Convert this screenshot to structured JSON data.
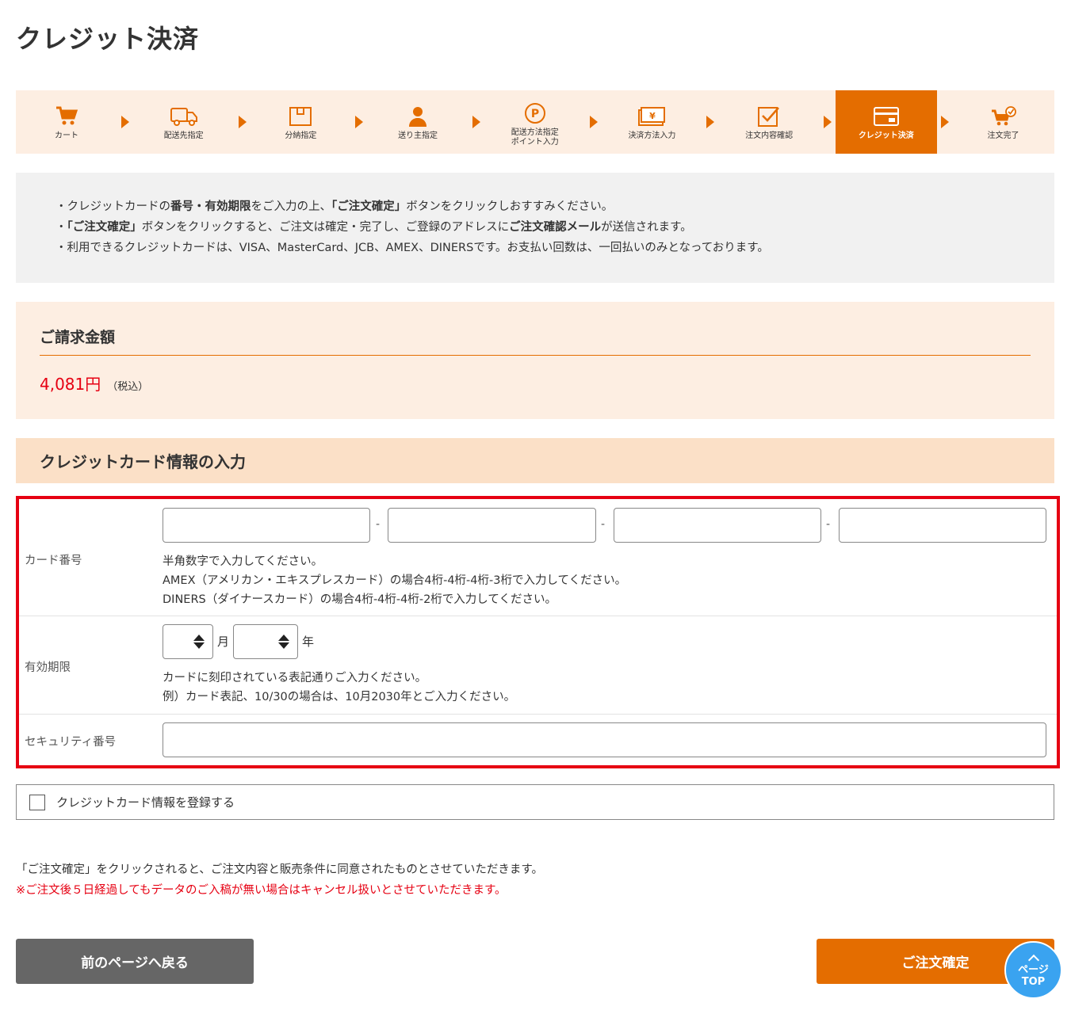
{
  "page": {
    "title": "クレジット決済"
  },
  "stepper": {
    "steps": [
      {
        "label": "カート",
        "icon": "cart-icon"
      },
      {
        "label": "配送先指定",
        "icon": "truck-icon"
      },
      {
        "label": "分納指定",
        "icon": "box-icon"
      },
      {
        "label": "送り主指定",
        "icon": "person-icon"
      },
      {
        "label": "配送方法指定\nポイント入力",
        "icon": "point-icon"
      },
      {
        "label": "決済方法入力",
        "icon": "yen-bill-icon"
      },
      {
        "label": "注文内容確認",
        "icon": "check-document-icon"
      },
      {
        "label": "クレジット決済",
        "icon": "credit-card-icon",
        "active": true
      },
      {
        "label": "注文完了",
        "icon": "cart-check-icon"
      }
    ],
    "accent": "#e46d00"
  },
  "notice": {
    "line1": {
      "a": "・クレジットカードの",
      "b": "番号・有効期限",
      "c": "をご入力の上、",
      "d": "「ご注文確定」",
      "e": "ボタンをクリックしおすすみください。"
    },
    "line2": {
      "a": "・",
      "b": "「ご注文確定」",
      "c": "ボタンをクリックすると、ご注文は確定・完了し、ご登録のアドレスに",
      "d": "ご注文確認メール",
      "e": "が送信されます。"
    },
    "line3": "・利用できるクレジットカードは、VISA、MasterCard、JCB、AMEX、DINERSです。お支払い回数は、一回払いのみとなっております。"
  },
  "billing": {
    "heading": "ご請求金額",
    "amount": "4,081円",
    "tax_note": "（税込）"
  },
  "card_section": {
    "heading": "クレジットカード情報の入力",
    "card_number": {
      "label": "カード番号",
      "separator": "-",
      "help1": "半角数字で入力してください。",
      "help2": "AMEX（アメリカン・エキスプレスカード）の場合4桁-4桁-4桁-3桁で入力してください。",
      "help3": "DINERS（ダイナースカード）の場合4桁-4桁-4桁-2桁で入力してください。"
    },
    "expiry": {
      "label": "有効期限",
      "month_unit": "月",
      "year_unit": "年",
      "help1": "カードに刻印されている表記通りご入力ください。",
      "help2": "例）カード表記、10/30の場合は、10月2030年とご入力ください。"
    },
    "security": {
      "label": "セキュリティ番号"
    }
  },
  "register": {
    "label": "クレジットカード情報を登録する",
    "checked": false
  },
  "agreement": {
    "text": "「ご注文確定」をクリックされると、ご注文内容と販売条件に同意されたものとさせていただきます。",
    "warning": "※ご注文後５日経過してもデータのご入稿が無い場合はキャンセル扱いとさせていただきます。"
  },
  "buttons": {
    "back": "前のページへ戻る",
    "confirm": "ご注文確定"
  },
  "page_top": {
    "line1": "ページ",
    "line2": "TOP"
  },
  "colors": {
    "accent": "#e46d00",
    "price": "#e60012",
    "highlight_border": "#e60012"
  }
}
